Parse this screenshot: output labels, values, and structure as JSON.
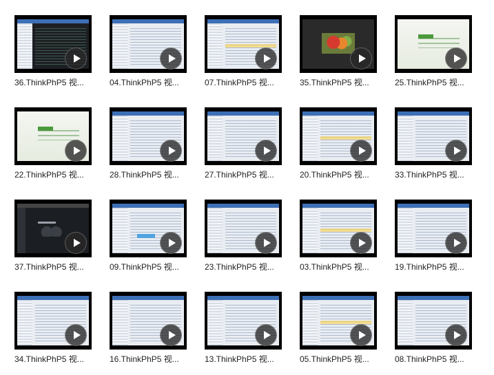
{
  "videos": [
    {
      "title": "36.ThinkPhP5 视...",
      "style": "dark"
    },
    {
      "title": "04.ThinkPhP5 视...",
      "style": "code"
    },
    {
      "title": "07.ThinkPhP5 视...",
      "style": "hilite"
    },
    {
      "title": "35.ThinkPhP5 视...",
      "style": "photo"
    },
    {
      "title": "25.ThinkPhP5 视...",
      "style": "promo"
    },
    {
      "title": "22.ThinkPhP5 视...",
      "style": "promo"
    },
    {
      "title": "28.ThinkPhP5 视...",
      "style": "code"
    },
    {
      "title": "27.ThinkPhP5 视...",
      "style": "code"
    },
    {
      "title": "20.ThinkPhP5 视...",
      "style": "hilite"
    },
    {
      "title": "33.ThinkPhP5 视...",
      "style": "code"
    },
    {
      "title": "37.ThinkPhP5 视...",
      "style": "slide"
    },
    {
      "title": "09.ThinkPhP5 视...",
      "style": "web"
    },
    {
      "title": "23.ThinkPhP5 视...",
      "style": "code"
    },
    {
      "title": "03.ThinkPhP5 视...",
      "style": "hilite"
    },
    {
      "title": "19.ThinkPhP5 视...",
      "style": "code"
    },
    {
      "title": "34.ThinkPhP5 视...",
      "style": "code"
    },
    {
      "title": "16.ThinkPhP5 视...",
      "style": "code"
    },
    {
      "title": "13.ThinkPhP5 视...",
      "style": "code"
    },
    {
      "title": "05.ThinkPhP5 视...",
      "style": "hilite"
    },
    {
      "title": "08.ThinkPhP5 视...",
      "style": "code"
    }
  ],
  "play_icon": "play-icon"
}
